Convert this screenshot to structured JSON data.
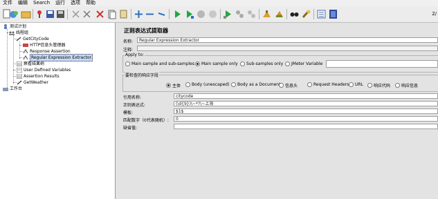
{
  "menu": [
    "文件",
    "编辑",
    "Search",
    "运行",
    "选项",
    "帮助"
  ],
  "toolbar": {
    "icons": [
      "new-icon",
      "templates-icon",
      "open-icon",
      "close-icon",
      "save-icon",
      "save-as-icon",
      "cut-icon",
      "copy-icon",
      "paste-icon",
      "undo-icon",
      "redo-icon",
      "expand-icon",
      "collapse-icon",
      "toggle-icon",
      "start-icon",
      "start-no-pause-icon",
      "stop-icon",
      "shutdown-icon",
      "remote-start-icon",
      "remote-stop-icon",
      "remote-shutdown-icon",
      "clear-icon",
      "clear-all-icon",
      "search-icon",
      "reset-search-icon",
      "function-helper-icon",
      "help-icon"
    ],
    "counter": "2/"
  },
  "tree": {
    "test_plan": "测试计划",
    "thread_group": "线程组",
    "sampler": "GetCityCode",
    "header_manager": "HTTP信息头管理器",
    "response_assertion": "Response Assertion",
    "regex_extractor": "Regular Expression Extractor",
    "results_tree": "察看结果树",
    "user_vars": "User Defined Variables",
    "assertion_results": "Assertion Results",
    "get_weather": "GetWeather",
    "workbench": "工作台"
  },
  "panel": {
    "title": "正则表达式提取器",
    "name_label": "名称:",
    "name_value": "Regular Expression Extractor",
    "comment_label": "注释:",
    "comment_value": "",
    "apply_to": {
      "title": "Apply to:",
      "options": [
        "Main sample and sub-samples",
        "Main sample only",
        "Sub-samples only",
        "JMeter Variable"
      ],
      "selected": "Main sample only",
      "variable_value": ""
    },
    "check_field": {
      "title": "要检查的响应字段",
      "options": [
        "主体",
        "Body (unescaped)",
        "Body as a Document",
        "信息头",
        "Request Headers",
        "URL",
        "响应代码",
        "响应信息"
      ],
      "selected": "主体"
    },
    "ref_label": "引用名称:",
    "ref_value": "citycode",
    "regex_label": "正则表达式:",
    "regex_value": "(\\d{9})\\~*?\\~上海",
    "template_label": "模板:",
    "template_value": "$1$",
    "match_label": "匹配数字（0代表随机）:",
    "match_value": "0",
    "default_label": "缺省值:",
    "default_value": ""
  },
  "colors": {
    "tree_bg": "#ffffff",
    "panel_bg": "#e3e3e3",
    "selection": "#c7daf5"
  }
}
